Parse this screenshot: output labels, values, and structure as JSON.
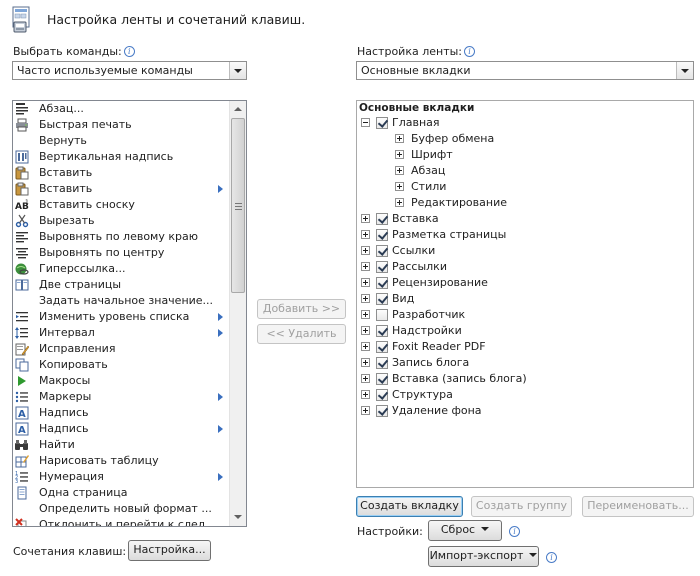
{
  "header": {
    "title": "Настройка ленты и сочетаний клавиш."
  },
  "left": {
    "label": "Выбрать команды:",
    "combo_value": "Часто используемые команды",
    "commands": [
      {
        "label": "Абзац...",
        "icon": "paragraph-icon",
        "submenu": false
      },
      {
        "label": "Быстрая печать",
        "icon": "printer-icon",
        "submenu": false
      },
      {
        "label": "Вернуть",
        "icon": "blank",
        "submenu": false
      },
      {
        "label": "Вертикальная надпись",
        "icon": "vertical-text-box-icon",
        "submenu": false
      },
      {
        "label": "Вставить",
        "icon": "paste-icon",
        "submenu": false
      },
      {
        "label": "Вставить",
        "icon": "paste-icon",
        "submenu": true
      },
      {
        "label": "Вставить сноску",
        "icon": "footnote-icon",
        "submenu": false
      },
      {
        "label": "Вырезать",
        "icon": "scissors-icon",
        "submenu": false
      },
      {
        "label": "Выровнять по левому краю",
        "icon": "align-left-icon",
        "submenu": false
      },
      {
        "label": "Выровнять по центру",
        "icon": "align-center-icon",
        "submenu": false
      },
      {
        "label": "Гиперссылка...",
        "icon": "hyperlink-icon",
        "submenu": false
      },
      {
        "label": "Две страницы",
        "icon": "two-pages-icon",
        "submenu": false
      },
      {
        "label": "Задать начальное значение...",
        "icon": "blank",
        "submenu": false
      },
      {
        "label": "Изменить уровень списка",
        "icon": "list-level-icon",
        "submenu": true
      },
      {
        "label": "Интервал",
        "icon": "line-spacing-icon",
        "submenu": true
      },
      {
        "label": "Исправления",
        "icon": "track-changes-icon",
        "submenu": false
      },
      {
        "label": "Копировать",
        "icon": "copy-icon",
        "submenu": false
      },
      {
        "label": "Макросы",
        "icon": "macro-play-icon",
        "submenu": false
      },
      {
        "label": "Маркеры",
        "icon": "bullets-icon",
        "submenu": true
      },
      {
        "label": "Надпись",
        "icon": "text-box-icon",
        "submenu": false
      },
      {
        "label": "Надпись",
        "icon": "text-box-icon",
        "submenu": true
      },
      {
        "label": "Найти",
        "icon": "find-icon",
        "submenu": false
      },
      {
        "label": "Нарисовать таблицу",
        "icon": "draw-table-icon",
        "submenu": false
      },
      {
        "label": "Нумерация",
        "icon": "numbering-icon",
        "submenu": true
      },
      {
        "label": "Одна страница",
        "icon": "one-page-icon",
        "submenu": false
      },
      {
        "label": "Определить новый формат ...",
        "icon": "blank",
        "submenu": false
      },
      {
        "label": "Отклонить и перейти к след...",
        "icon": "reject-icon",
        "submenu": false
      }
    ],
    "shortcuts_label": "Сочетания клавиш:",
    "shortcuts_button": "Настройка..."
  },
  "middle": {
    "add_button": "Добавить >>",
    "remove_button": "<< Удалить"
  },
  "right": {
    "label": "Настройка ленты:",
    "combo_value": "Основные вкладки",
    "tree_header": "Основные вкладки",
    "tree": [
      {
        "label": "Главная",
        "level": 0,
        "expander": "minus",
        "checked": true
      },
      {
        "label": "Буфер обмена",
        "level": 1,
        "expander": "plus",
        "checked": null
      },
      {
        "label": "Шрифт",
        "level": 1,
        "expander": "plus",
        "checked": null
      },
      {
        "label": "Абзац",
        "level": 1,
        "expander": "plus",
        "checked": null
      },
      {
        "label": "Стили",
        "level": 1,
        "expander": "plus",
        "checked": null
      },
      {
        "label": "Редактирование",
        "level": 1,
        "expander": "plus",
        "checked": null
      },
      {
        "label": "Вставка",
        "level": 0,
        "expander": "plus",
        "checked": true
      },
      {
        "label": "Разметка страницы",
        "level": 0,
        "expander": "plus",
        "checked": true
      },
      {
        "label": "Ссылки",
        "level": 0,
        "expander": "plus",
        "checked": true
      },
      {
        "label": "Рассылки",
        "level": 0,
        "expander": "plus",
        "checked": true
      },
      {
        "label": "Рецензирование",
        "level": 0,
        "expander": "plus",
        "checked": true
      },
      {
        "label": "Вид",
        "level": 0,
        "expander": "plus",
        "checked": true
      },
      {
        "label": "Разработчик",
        "level": 0,
        "expander": "plus",
        "checked": false
      },
      {
        "label": "Надстройки",
        "level": 0,
        "expander": "plus",
        "checked": true
      },
      {
        "label": "Foxit Reader PDF",
        "level": 0,
        "expander": "plus",
        "checked": true
      },
      {
        "label": "Запись блога",
        "level": 0,
        "expander": "plus",
        "checked": true
      },
      {
        "label": "Вставка (запись блога)",
        "level": 0,
        "expander": "plus",
        "checked": true
      },
      {
        "label": "Структура",
        "level": 0,
        "expander": "plus",
        "checked": true
      },
      {
        "label": "Удаление фона",
        "level": 0,
        "expander": "plus",
        "checked": true
      }
    ],
    "new_tab_button": "Создать вкладку",
    "new_group_button": "Создать группу",
    "rename_button": "Переименовать...",
    "settings_label": "Настройки:",
    "reset_button": "Сброс",
    "import_export_button": "Импорт-экспорт"
  }
}
